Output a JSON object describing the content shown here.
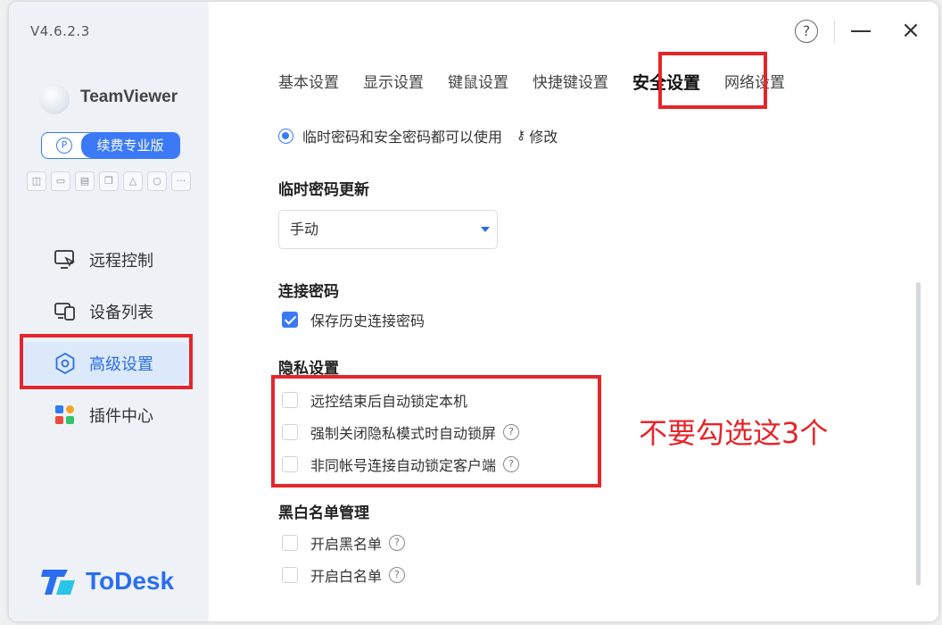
{
  "app": {
    "version": "V4.6.2.3",
    "brand_partner": "TeamViewer",
    "edition_badge": "续费专业版",
    "brand_name": "ToDesk"
  },
  "sidebar": {
    "mini_icons": [
      "gamepad-icon",
      "monitor-icon",
      "folder-icon",
      "copy-icon",
      "rocket-icon",
      "circle-icon",
      "more-icon"
    ],
    "items": [
      {
        "label": "远程控制",
        "icon": "remote-control-icon"
      },
      {
        "label": "设备列表",
        "icon": "device-list-icon"
      },
      {
        "label": "高级设置",
        "icon": "settings-hex-icon",
        "active": true
      },
      {
        "label": "插件中心",
        "icon": "plugin-grid-icon"
      }
    ]
  },
  "window_controls": {
    "help": "?",
    "close": "×"
  },
  "tabs": [
    "基本设置",
    "显示设置",
    "键鼠设置",
    "快捷键设置",
    "安全设置",
    "网络设置"
  ],
  "active_tab": "安全设置",
  "password_mode": {
    "option_label": "临时密码和安全密码都可以使用",
    "edit_label": "修改"
  },
  "temp_password_update": {
    "title": "临时密码更新",
    "selected": "手动"
  },
  "connection_password": {
    "title": "连接密码",
    "save_history_label": "保存历史连接密码",
    "save_history_checked": true
  },
  "privacy": {
    "title": "隐私设置",
    "options": [
      {
        "label": "远控结束后自动锁定本机",
        "checked": false,
        "help": false
      },
      {
        "label": "强制关闭隐私模式时自动锁屏",
        "checked": false,
        "help": true
      },
      {
        "label": "非同帐号连接自动锁定客户端",
        "checked": false,
        "help": true
      }
    ]
  },
  "blacklist": {
    "title": "黑白名单管理",
    "options": [
      {
        "label": "开启黑名单",
        "checked": false
      },
      {
        "label": "开启白名单",
        "checked": false
      }
    ]
  },
  "annotation": {
    "note": "不要勾选这3个",
    "color": "#e4262b"
  },
  "colors": {
    "accent": "#3b79f6",
    "sidebar_bg": "#eef2f7",
    "highlight": "#e4262b"
  }
}
